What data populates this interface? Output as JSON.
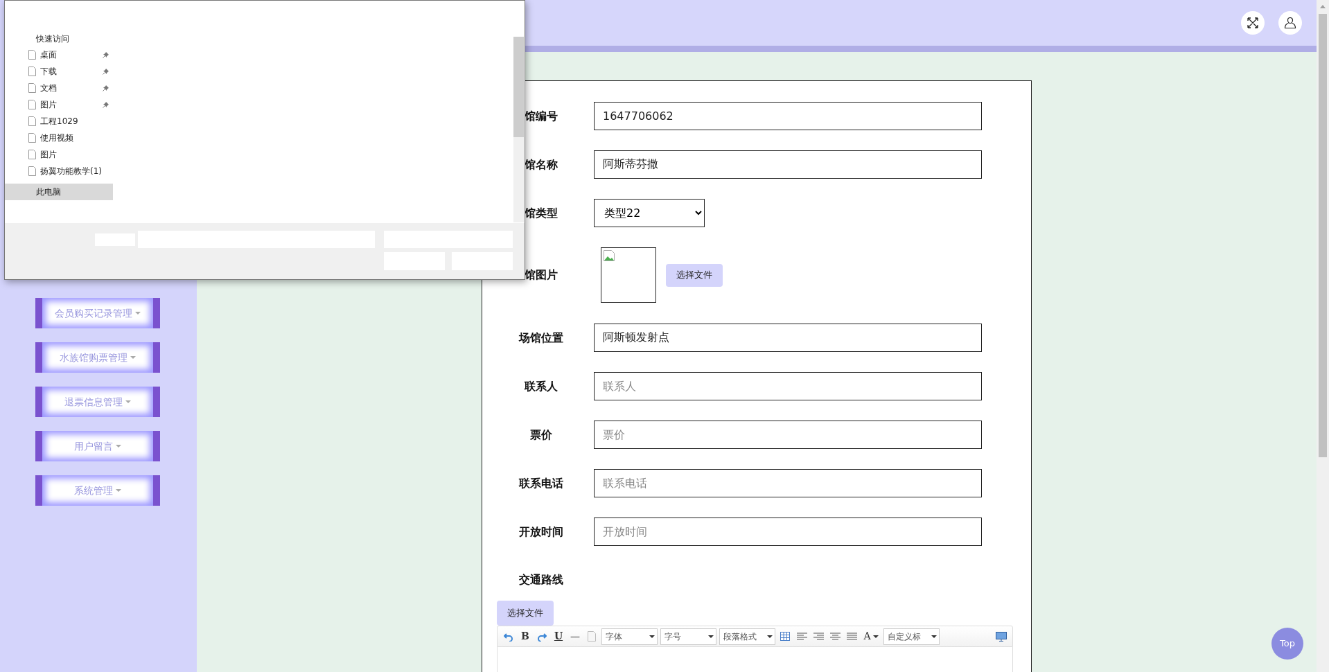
{
  "sidebar": {
    "items": [
      {
        "label": "会员购买记录管理"
      },
      {
        "label": "水族馆购票管理"
      },
      {
        "label": "退票信息管理"
      },
      {
        "label": "用户留言"
      },
      {
        "label": "系统管理"
      }
    ]
  },
  "form": {
    "fields": [
      {
        "kind": "text",
        "label": "馆编号",
        "value": "1647706062"
      },
      {
        "kind": "text",
        "label": "馆名称",
        "value": "阿斯蒂芬撒"
      },
      {
        "kind": "select",
        "label": "馆类型",
        "value": "类型22"
      },
      {
        "kind": "image",
        "label": "馆图片",
        "button": "选择文件"
      },
      {
        "kind": "text",
        "label": "场馆位置",
        "value": "阿斯顿发射点"
      },
      {
        "kind": "text",
        "label": "联系人",
        "placeholder": "联系人"
      },
      {
        "kind": "text",
        "label": "票价",
        "placeholder": "票价"
      },
      {
        "kind": "text",
        "label": "联系电话",
        "placeholder": "联系电话"
      },
      {
        "kind": "text",
        "label": "开放时间",
        "placeholder": "开放时间"
      },
      {
        "kind": "editor",
        "label": "交通路线",
        "button": "选择文件",
        "toolbar": [
          {
            "kind": "undo"
          },
          {
            "kind": "text",
            "text": "B"
          },
          {
            "kind": "redo"
          },
          {
            "kind": "underline",
            "text": "U"
          },
          {
            "kind": "text",
            "text": "—"
          },
          {
            "kind": "page"
          },
          {
            "kind": "dropdown",
            "text": "字体"
          },
          {
            "kind": "dropdown",
            "text": "字号"
          },
          {
            "kind": "dropdown",
            "text": "段落格式"
          },
          {
            "kind": "table"
          },
          {
            "kind": "align-left"
          },
          {
            "kind": "align-right"
          },
          {
            "kind": "align-center"
          },
          {
            "kind": "justify"
          },
          {
            "kind": "color",
            "text": "A"
          },
          {
            "kind": "dropdown",
            "text": "自定义标"
          },
          {
            "kind": "preview"
          }
        ]
      }
    ]
  },
  "top_button": "Top",
  "file_dialog": {
    "quick_access": {
      "label": "快速访问",
      "items": [
        {
          "label": "桌面",
          "pinned": true
        },
        {
          "label": "下载",
          "pinned": true
        },
        {
          "label": "文档",
          "pinned": true
        },
        {
          "label": "图片",
          "pinned": true
        },
        {
          "label": "工程1029",
          "pinned": false
        },
        {
          "label": "使用视频",
          "pinned": false
        },
        {
          "label": "图片",
          "pinned": false
        },
        {
          "label": "扬翼功能教学(1)",
          "pinned": false
        }
      ]
    },
    "this_pc": {
      "label": "此电脑",
      "selected": true
    }
  }
}
